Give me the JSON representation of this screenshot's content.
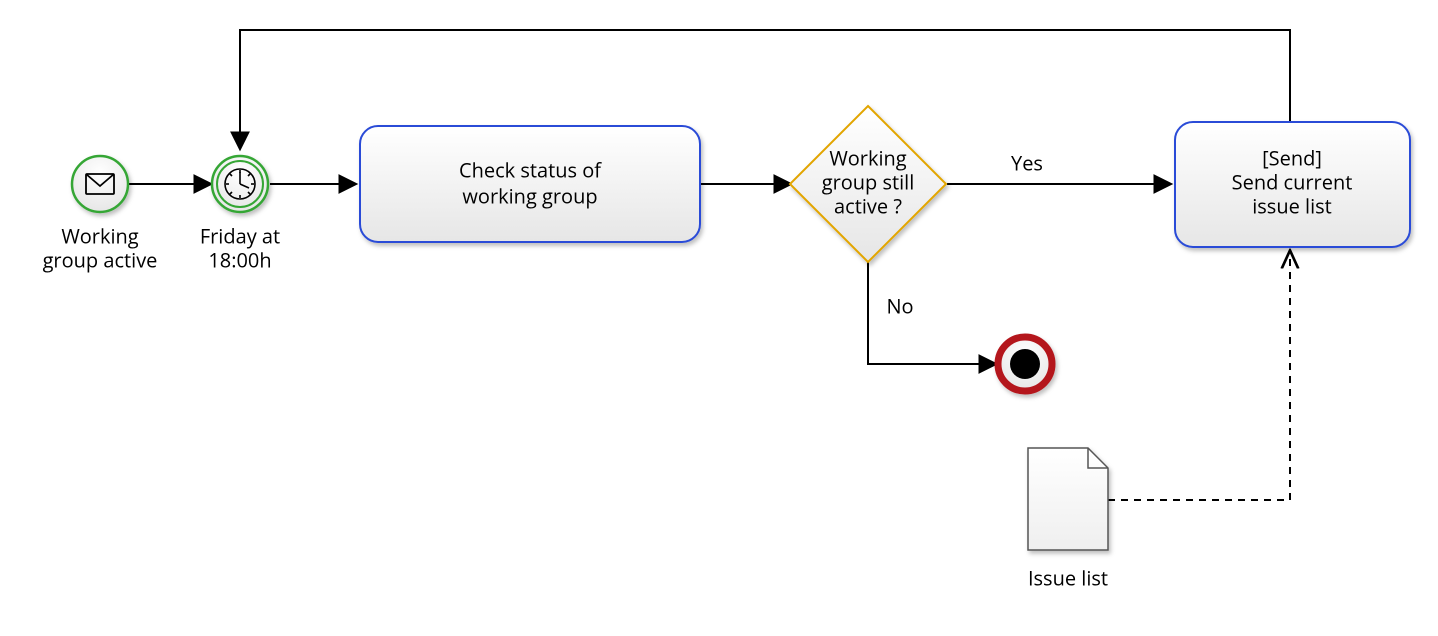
{
  "diagram": {
    "type": "BPMN",
    "start_event": {
      "label_line1": "Working",
      "label_line2": "group active",
      "icon": "envelope"
    },
    "timer_event": {
      "label_line1": "Friday at",
      "label_line2": "18:00h",
      "icon": "clock"
    },
    "task_check": {
      "label_line1": "Check status of",
      "label_line2": "working group"
    },
    "gateway": {
      "label_line1": "Working",
      "label_line2": "group still",
      "label_line3": "active ?"
    },
    "edge_yes": "Yes",
    "edge_no": "No",
    "end_event": {
      "type": "terminate"
    },
    "task_send": {
      "label_line1": "[Send]",
      "label_line2": "Send current",
      "label_line3": "issue list"
    },
    "data_object": {
      "label": "Issue list"
    }
  }
}
